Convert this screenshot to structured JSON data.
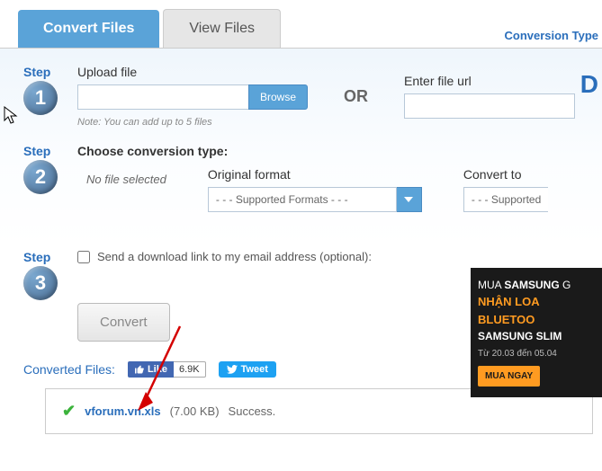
{
  "tabs": {
    "convert": "Convert Files",
    "view": "View Files"
  },
  "link_conversion_types": "Conversion Type",
  "drop_char": "D",
  "step": {
    "label": "Step",
    "n1": "1",
    "n2": "2",
    "n3": "3"
  },
  "upload": {
    "title": "Upload file",
    "browse": "Browse",
    "note": "Note: You can add up to 5 files"
  },
  "or": "OR",
  "url_title": "Enter file url",
  "choose_type": "Choose conversion type:",
  "no_file": "No file selected",
  "original": {
    "label": "Original format",
    "value": "- - - Supported Formats - - -"
  },
  "convert_to": {
    "label": "Convert to",
    "value": "- - - Supported"
  },
  "email_opt": "Send a download link to my email address (optional):",
  "convert_btn": "Convert",
  "converted_label": "Converted Files:",
  "fb": {
    "like": "Like",
    "count": "6.9K"
  },
  "tweet": "Tweet",
  "result": {
    "name": "vforum.vn.xls",
    "size": "(7.00 KB)",
    "status": "Success."
  },
  "ad": {
    "l1a": "MUA ",
    "l1b": "SAMSUNG",
    "l1c": " G",
    "l2": "NHẬN LOA BLUETOO",
    "l3": "SAMSUNG SLIM",
    "date": "Từ 20.03 đến 05.04",
    "btn": "MUA NGAY"
  }
}
